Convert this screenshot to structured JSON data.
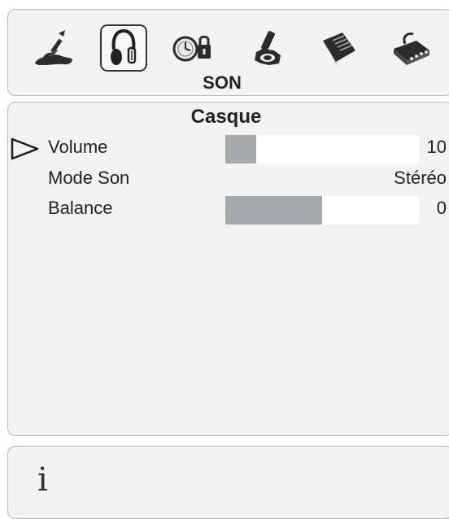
{
  "menu": {
    "title": "SON",
    "selected_index": 1,
    "icons": [
      {
        "name": "picture-brush-icon"
      },
      {
        "name": "headphones-icon"
      },
      {
        "name": "clock-lock-icon"
      },
      {
        "name": "settings-wrench-icon"
      },
      {
        "name": "guide-book-icon"
      },
      {
        "name": "source-connector-icon"
      }
    ]
  },
  "section": {
    "title": "Casque"
  },
  "rows": [
    {
      "label": "Volume",
      "type": "slider",
      "value": "10",
      "level": 0.16,
      "selected": true
    },
    {
      "label": "Mode Son",
      "type": "text",
      "value": "Stéréo",
      "selected": false
    },
    {
      "label": "Balance",
      "type": "slider",
      "value": "0",
      "level": 0.5,
      "selected": false
    }
  ],
  "info": {
    "icon": "info-icon",
    "glyph": "i"
  },
  "colors": {
    "panel_bg": "#f2f2f2",
    "bar_fill": "#a5a8ad",
    "bar_track": "#ffffff",
    "selection_border": "#333333"
  }
}
